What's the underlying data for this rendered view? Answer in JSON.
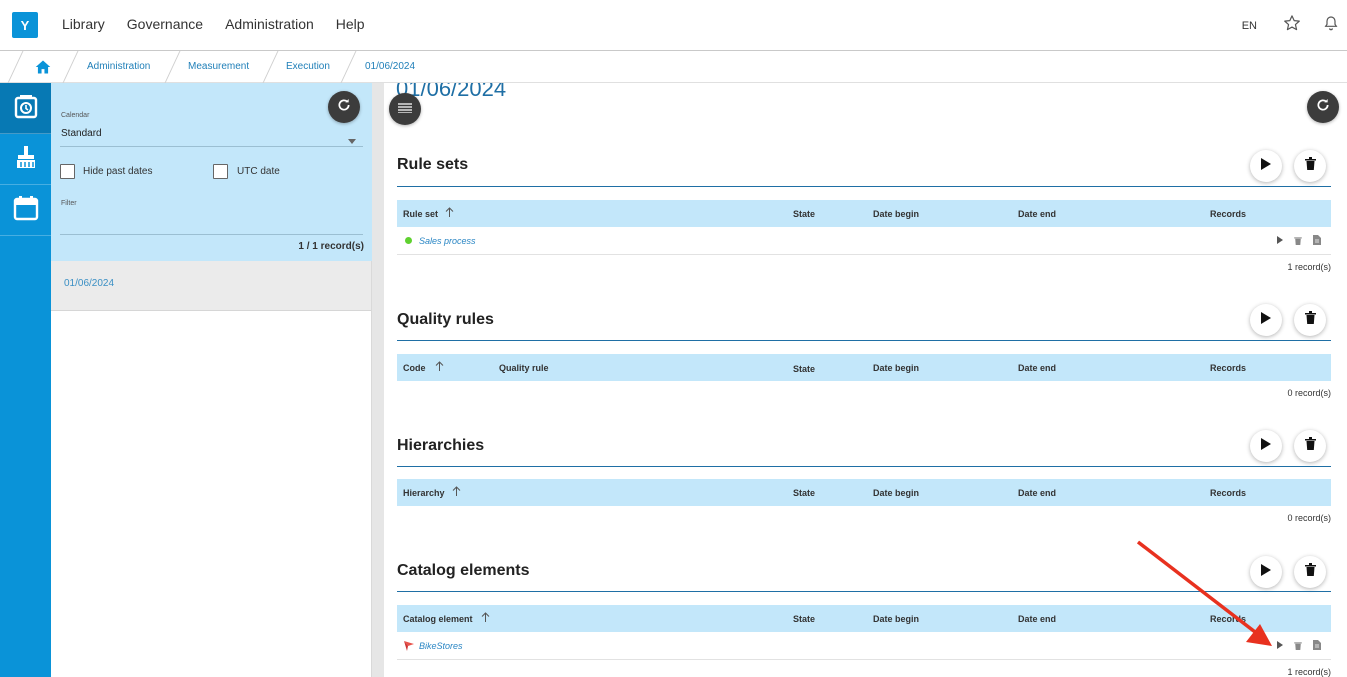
{
  "topbar": {
    "logo": "Y",
    "menu": [
      "Library",
      "Governance",
      "Administration",
      "Help"
    ],
    "lang": "EN"
  },
  "breadcrumb": [
    "Administration",
    "Measurement",
    "Execution",
    "01/06/2024"
  ],
  "panel": {
    "calendar_label": "Calendar",
    "calendar_value": "Standard",
    "hide_past_label": "Hide past dates",
    "utc_label": "UTC date",
    "filter_label": "Filter",
    "records": "1 / 1 record(s)",
    "items": [
      "01/06/2024"
    ]
  },
  "main": {
    "title": "01/06/2024",
    "rule_sets": {
      "title": "Rule sets",
      "columns": [
        "Rule set",
        "State",
        "Date begin",
        "Date end",
        "Records"
      ],
      "rows": [
        {
          "name": "Sales process"
        }
      ],
      "count": "1 record(s)"
    },
    "quality_rules": {
      "title": "Quality rules",
      "columns": [
        "Code",
        "Quality rule",
        "State",
        "Date begin",
        "Date end",
        "Records"
      ],
      "count": "0 record(s)"
    },
    "hierarchies": {
      "title": "Hierarchies",
      "columns": [
        "Hierarchy",
        "State",
        "Date begin",
        "Date end",
        "Records"
      ],
      "count": "0 record(s)"
    },
    "catalog": {
      "title": "Catalog elements",
      "columns": [
        "Catalog element",
        "State",
        "Date begin",
        "Date end",
        "Records"
      ],
      "rows": [
        {
          "name": "BikeStores"
        }
      ],
      "count": "1 record(s)"
    }
  },
  "colors": {
    "accent": "#0a93d8",
    "header_bg": "#c3e7fa",
    "title": "#1f6fa5",
    "arrow": "#e8311f",
    "status_green": "#5fd130"
  }
}
